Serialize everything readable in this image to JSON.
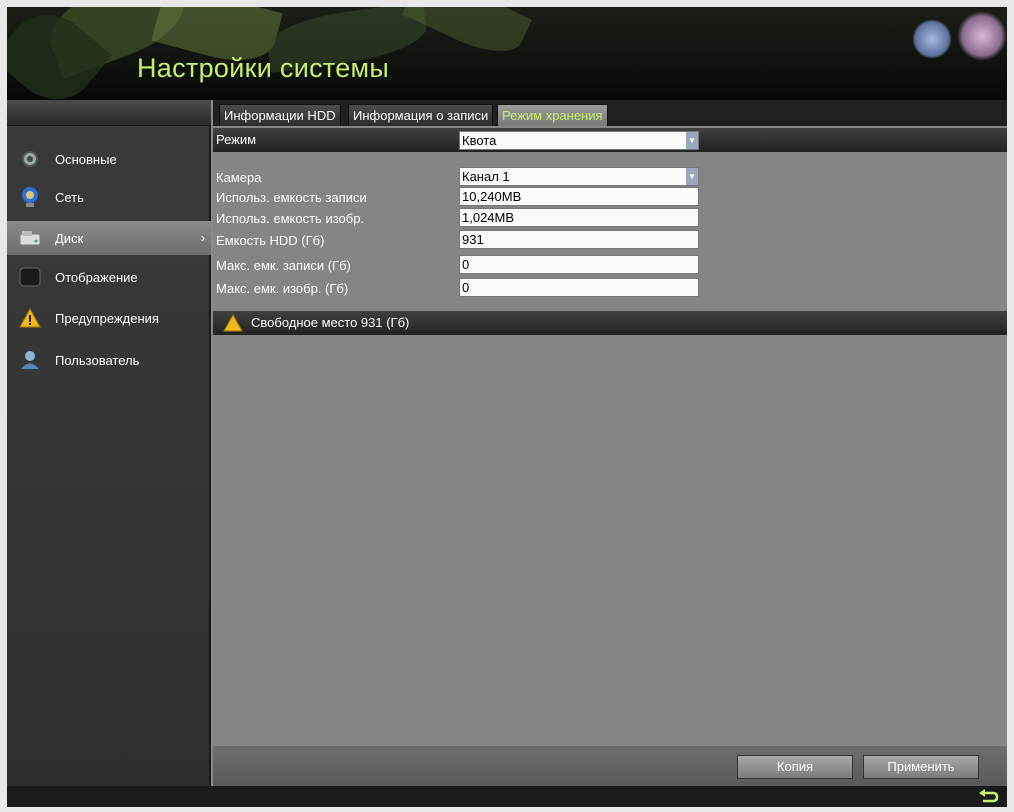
{
  "header": {
    "title": "Настройки системы"
  },
  "sidebar": {
    "items": [
      {
        "label": "Основные",
        "icon": "settings-icon"
      },
      {
        "label": "Сеть",
        "icon": "network-icon"
      },
      {
        "label": "Диск",
        "icon": "disk-icon",
        "active": true
      },
      {
        "label": "Отображение",
        "icon": "display-icon"
      },
      {
        "label": "Предупреждения",
        "icon": "warning-icon"
      },
      {
        "label": "Пользователь",
        "icon": "user-icon"
      }
    ]
  },
  "tabs": [
    {
      "label": "Информации HDD"
    },
    {
      "label": "Информация о записи"
    },
    {
      "label": "Режим хранения",
      "active": true
    }
  ],
  "form": {
    "mode_label": "Режим",
    "mode_value": "Квота",
    "camera_label": "Камера",
    "camera_value": "Канал 1",
    "used_record_label": "Использ. емкость записи",
    "used_record_value": "10,240MB",
    "used_image_label": "Использ. емкость изобр.",
    "used_image_value": "1,024MB",
    "hdd_capacity_label": "Емкость HDD (Гб)",
    "hdd_capacity_value": "931",
    "max_record_label": "Макс. емк. записи (Гб)",
    "max_record_value": "0",
    "max_image_label": "Макс. емк. изобр. (Гб)",
    "max_image_value": "0"
  },
  "notice": {
    "text": "Свободное место 931 (Гб)"
  },
  "buttons": {
    "copy": "Копия",
    "apply": "Применить"
  },
  "colors": {
    "accent": "#c6f06a",
    "active_tab_text": "#c6f06a"
  }
}
